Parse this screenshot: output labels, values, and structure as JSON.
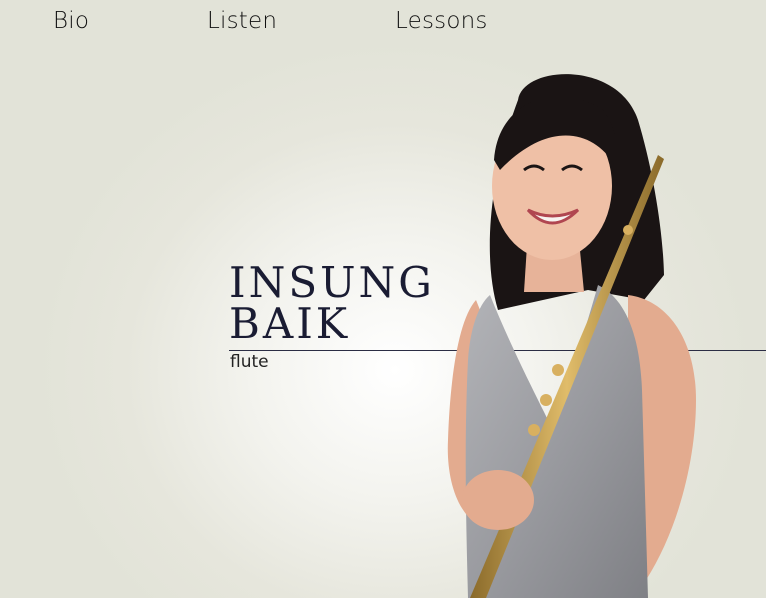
{
  "nav": {
    "bio": "Bio",
    "listen": "Listen",
    "lessons": "Lessons"
  },
  "hero": {
    "first_name": "INSUNG",
    "last_name": "BAIK",
    "instrument": "flute"
  },
  "colors": {
    "background": "#e2e3d8",
    "name_text": "#1a1c33",
    "dress": "#9a9ba0",
    "flute_gold": "#c8a04a",
    "hair": "#1a1414"
  }
}
